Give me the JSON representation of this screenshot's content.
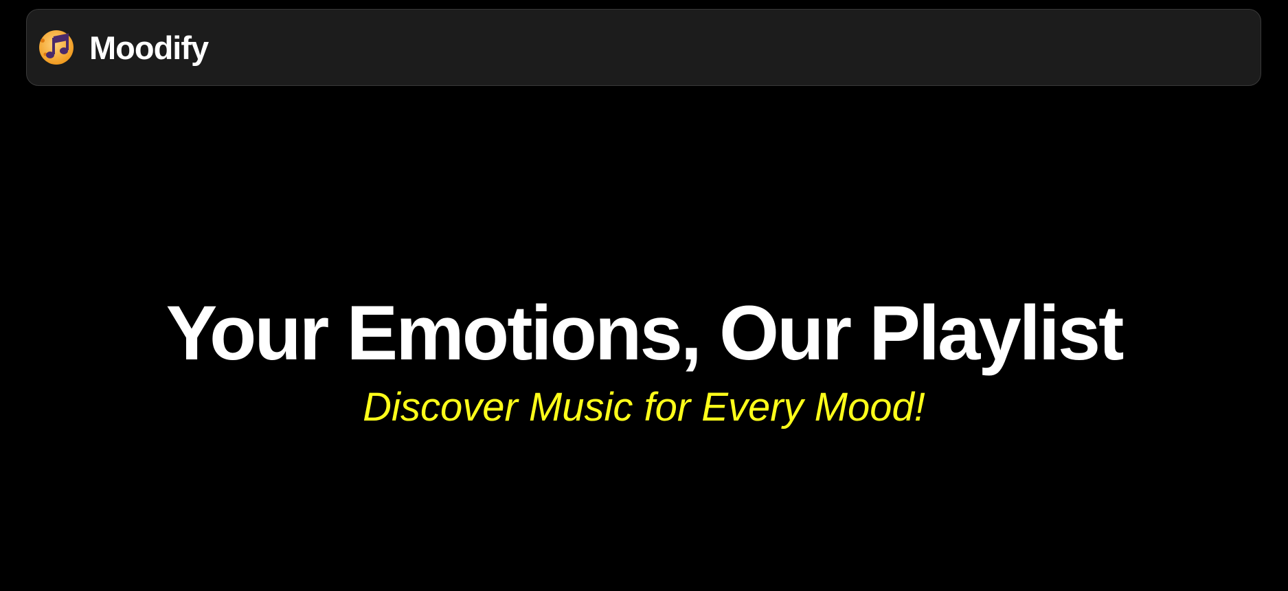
{
  "navbar": {
    "brand_name": "Moodify",
    "logo_icon": "music-note-disc-icon"
  },
  "hero": {
    "title": "Your Emotions, Our Playlist",
    "subtitle": "Discover Music for Every Mood!"
  },
  "colors": {
    "background": "#000000",
    "navbar_bg": "#1c1c1c",
    "title_text": "#ffffff",
    "subtitle_text": "#ffff1a",
    "logo_orange": "#f5a623",
    "logo_purple": "#4a2a6a"
  }
}
